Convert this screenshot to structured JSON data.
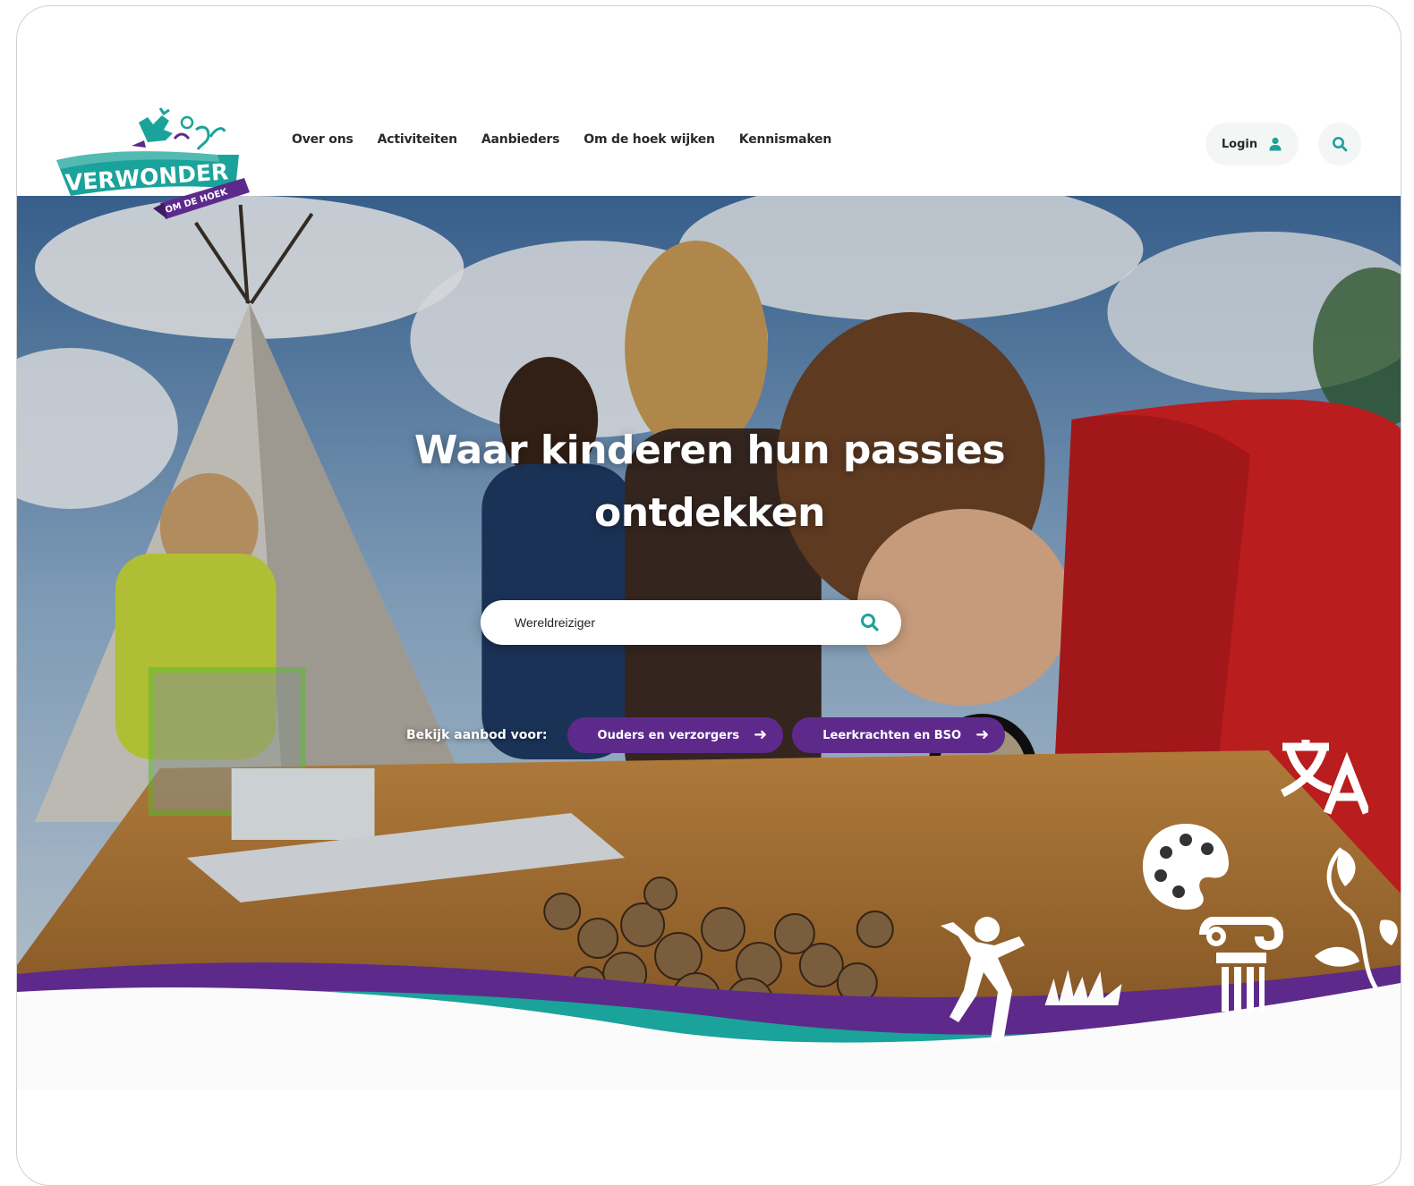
{
  "brand": {
    "name_top": "VERWONDER",
    "name_bottom": "OM DE HOEK",
    "colors": {
      "teal": "#1aa39a",
      "purple": "#5d2a8c",
      "white": "#ffffff"
    }
  },
  "nav": {
    "items": [
      {
        "label": "Over ons"
      },
      {
        "label": "Activiteiten"
      },
      {
        "label": "Aanbieders"
      },
      {
        "label": "Om de hoek wijken"
      },
      {
        "label": "Kennismaken"
      }
    ]
  },
  "header_actions": {
    "login_label": "Login",
    "login_icon": "user-icon",
    "search_icon": "search-icon"
  },
  "hero": {
    "title_line1": "Waar kinderen hun passies",
    "title_line2": "ontdekken",
    "search_value": "Wereldreiziger",
    "offer_label": "Bekijk aanbod voor:",
    "buttons": [
      {
        "label": "Ouders en verzorgers",
        "icon": "arrow-right-icon"
      },
      {
        "label": "Leerkrachten en BSO",
        "icon": "arrow-right-icon"
      }
    ],
    "decorative_icons": [
      "translate-icon",
      "palette-icon",
      "column-icon",
      "plant-icon",
      "dancer-icon"
    ]
  }
}
